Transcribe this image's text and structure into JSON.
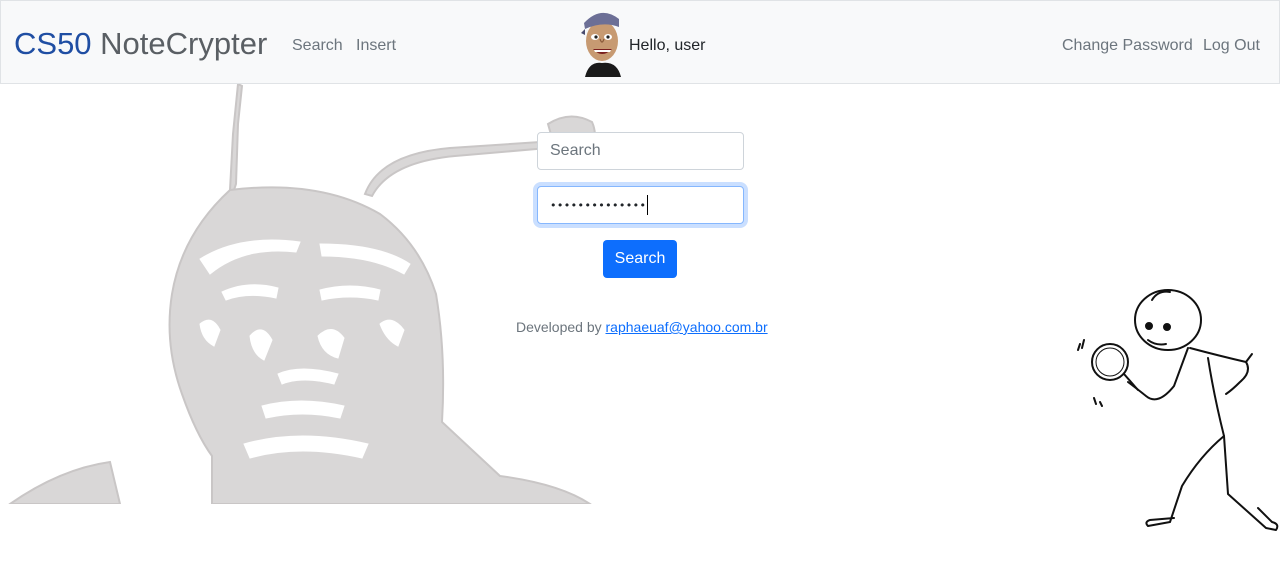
{
  "navbar": {
    "brand_part1": "CS50",
    "brand_part2": "NoteCrypter",
    "links": [
      "Search",
      "Insert"
    ],
    "greeting": "Hello, user",
    "right_links": [
      "Change Password",
      "Log Out"
    ]
  },
  "form": {
    "search_placeholder": "Search",
    "password_value": "••••••••••••••",
    "submit_label": "Search"
  },
  "footer": {
    "prefix": "Developed by",
    "email": "raphaeuaf@yahoo.com.br"
  },
  "colors": {
    "accent": "#0d6efd",
    "brand_blue": "#1f4ea3",
    "navbar_bg": "#f8f9fa"
  }
}
